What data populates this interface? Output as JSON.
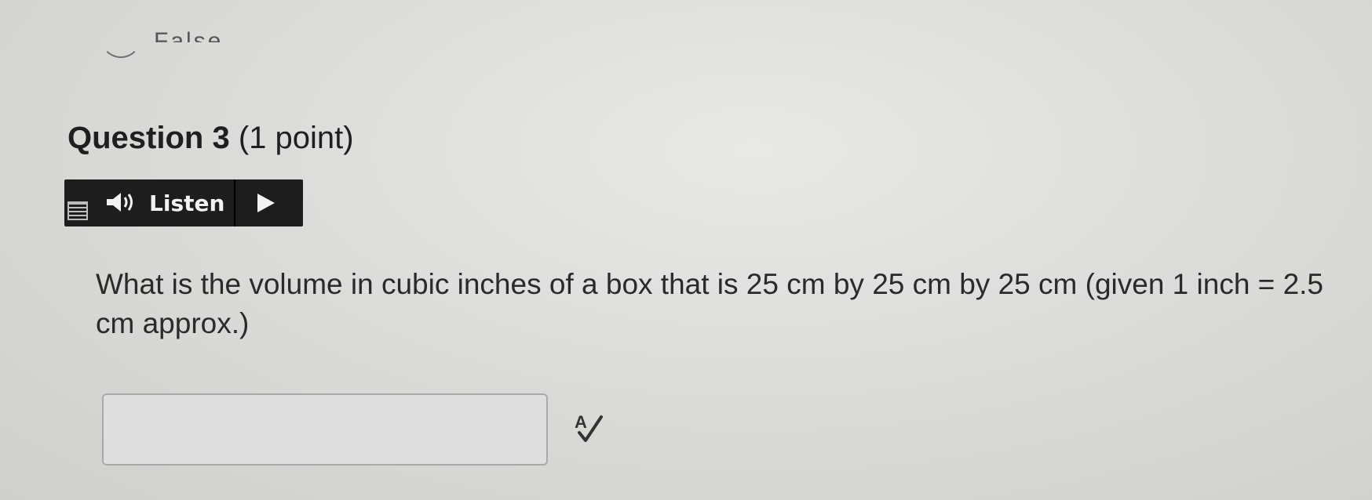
{
  "previous_option": {
    "label": "False"
  },
  "question": {
    "title": "Question 3",
    "points": "(1 point)",
    "text": "What is the volume in cubic inches of a box that is 25 cm by 25 cm by 25 cm (given 1 inch = 2.5 cm approx.)"
  },
  "listen": {
    "label": "Listen",
    "icons": {
      "menu": "menu-icon",
      "speaker": "speaker-icon",
      "play": "play-icon"
    },
    "colors": {
      "background": "#1d1d1d",
      "text": "#f2f2f2"
    }
  },
  "answer": {
    "value": "",
    "placeholder": ""
  },
  "spellcheck": {
    "icon": "spellcheck-icon"
  }
}
